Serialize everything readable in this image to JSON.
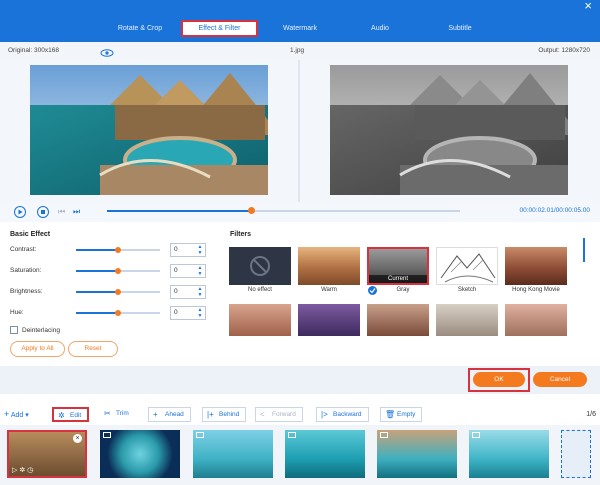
{
  "tabs": [
    "Rotate & Crop",
    "Effect & Filter",
    "Watermark",
    "Audio",
    "Subtitle"
  ],
  "info": {
    "original": "Original: 300x168",
    "filename": "1.jpg",
    "output": "Output: 1280x720"
  },
  "player": {
    "time": "00:00:02.01/00:00:05.00"
  },
  "basic_effect": {
    "title": "Basic Effect",
    "sliders": [
      {
        "label": "Contrast:",
        "value": "0",
        "level": 0.5
      },
      {
        "label": "Saturation:",
        "value": "0",
        "level": 0.5
      },
      {
        "label": "Brightness:",
        "value": "0",
        "level": 0.5
      },
      {
        "label": "Hue:",
        "value": "0",
        "level": 0.5
      }
    ],
    "deinterlacing": "Deinterlacing",
    "apply_all": "Apply to All",
    "reset": "Reset"
  },
  "filters": {
    "title": "Filters",
    "items": [
      "No effect",
      "Warm",
      "Gray",
      "Sketch",
      "Hong Kong Movie"
    ],
    "current_badge": "Current",
    "selected": "Gray"
  },
  "dialog": {
    "ok": "OK",
    "cancel": "Cancel"
  },
  "toolbar": {
    "add": "Add",
    "edit": "Edit",
    "trim": "Trim",
    "ahead": "Ahead",
    "behind": "Behind",
    "forward": "Forward",
    "backward": "Backward",
    "empty": "Empty",
    "page": "1/6"
  },
  "colors": {
    "accent": "#1a73d9",
    "orange": "#f47a20",
    "highlight": "#d7333f"
  }
}
